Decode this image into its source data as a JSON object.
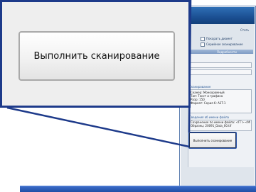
{
  "zoom_callout": {
    "button_label": "Выполнить сканирование"
  },
  "background_window": {
    "title_fragment": "Стать",
    "checkboxes": [
      {
        "label": "Покарать диамет"
      },
      {
        "label": "Серийное сканирование"
      }
    ],
    "tab_label": "Подробности",
    "sections": {
      "scanning_title": "Сканирование",
      "scanning_text": [
        "Сканер: Монохромный",
        "Тип: Текст и графика",
        "Разр: 150",
        "Формат: Серия 6: A2T-1"
      ],
      "file_info_title": "Сведения об имени файла",
      "file_info_text": [
        "Сохранение по имени файла: <ГГ>-<ММ>-<ДД>_Data_<0D_I",
        "Образец: 20091_Data_00.tif"
      ]
    },
    "scan_button_label": "Выполнить сканирование"
  },
  "colors": {
    "zoom_border": "#1d3a8a",
    "button_border": "#a9a9a9",
    "titlebar": "#1b4f92"
  }
}
